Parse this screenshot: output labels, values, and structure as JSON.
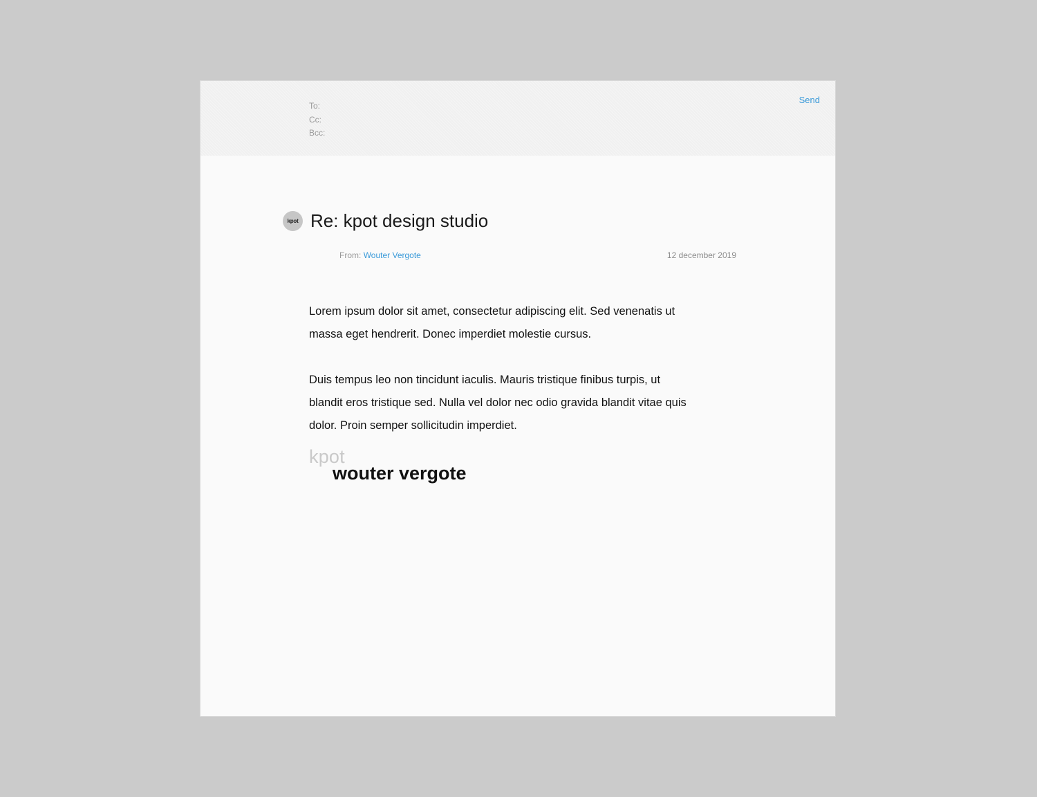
{
  "header": {
    "to_label": "To:",
    "cc_label": "Cc:",
    "bcc_label": "Bcc:",
    "send_label": "Send"
  },
  "message": {
    "avatar_text": "kpot",
    "subject": "Re: kpot design studio",
    "from_label": "From:",
    "from_name": "Wouter Vergote",
    "date": "12 december 2019",
    "paragraphs": [
      "Lorem ipsum dolor sit amet, consectetur adipiscing elit. Sed venenatis ut massa eget hendrerit. Donec imperdiet molestie cursus.",
      "Duis tempus leo non tincidunt iaculis. Mauris tristique finibus turpis, ut blandit eros tristique sed. Nulla vel dolor nec odio gravida blandit vitae quis dolor. Proin semper sollicitudin imperdiet."
    ],
    "signature": {
      "brand": "kpot",
      "name": "wouter vergote"
    }
  },
  "colors": {
    "accent": "#3a9ad9",
    "background": "#cbcbcb",
    "window": "#fafafa"
  }
}
